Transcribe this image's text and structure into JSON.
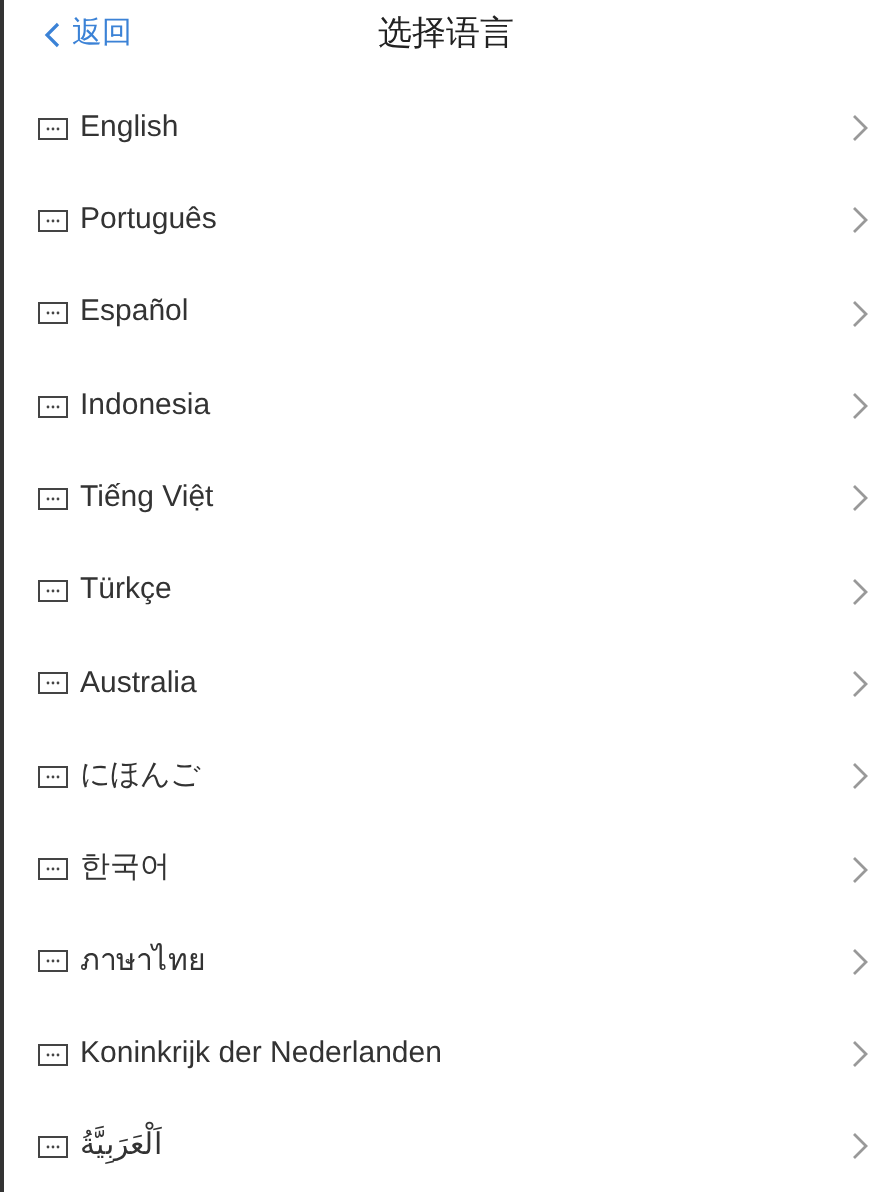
{
  "header": {
    "back": "返回",
    "title": "选择语言"
  },
  "languages": [
    {
      "label": "English"
    },
    {
      "label": "Português"
    },
    {
      "label": "Español"
    },
    {
      "label": "Indonesia"
    },
    {
      "label": "Tiếng Việt"
    },
    {
      "label": "Türkçe"
    },
    {
      "label": "Australia"
    },
    {
      "label": "にほんご"
    },
    {
      "label": "한국어"
    },
    {
      "label": "ภาษาไทย"
    },
    {
      "label": "Koninkrijk der Nederlanden"
    },
    {
      "label": "اَلْعَرَبِيَّةُ"
    }
  ]
}
